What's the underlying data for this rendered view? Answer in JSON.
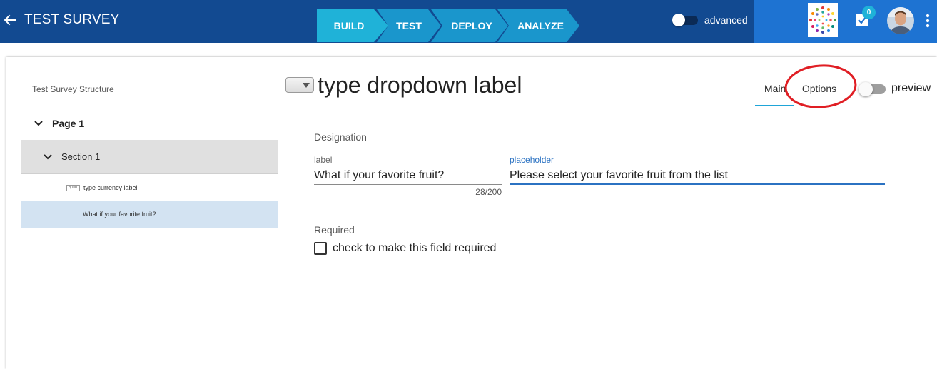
{
  "header": {
    "title": "TEST SURVEY",
    "steps": [
      "BUILD",
      "TEST",
      "DEPLOY",
      "ANALYZE"
    ],
    "active_step": "BUILD",
    "advanced_label": "advanced",
    "advanced_on": false,
    "tasks_count": "0",
    "colors": {
      "bar": "#124a91",
      "bar_right": "#1e73d2",
      "active_step": "#1fb2d8",
      "step": "#1a96cc"
    }
  },
  "structure": {
    "title": "Test Survey Structure",
    "page": "Page 1",
    "section": "Section 1",
    "questions": [
      {
        "icon_text": "$100",
        "label": "type currency label"
      },
      {
        "label": "What if your favorite fruit?"
      }
    ]
  },
  "editor": {
    "question_title": "type dropdown label",
    "tabs": {
      "main": "Main",
      "options": "Options"
    },
    "preview_label": "preview",
    "preview_on": false,
    "designation_heading": "Designation",
    "label_caption": "label",
    "label_value": "What if your favorite fruit?",
    "label_counter": "28/200",
    "placeholder_caption": "placeholder",
    "placeholder_value": "Please select your favorite fruit from the list",
    "required_heading": "Required",
    "required_checkbox_label": "check to make this field required",
    "required_checked": false
  }
}
